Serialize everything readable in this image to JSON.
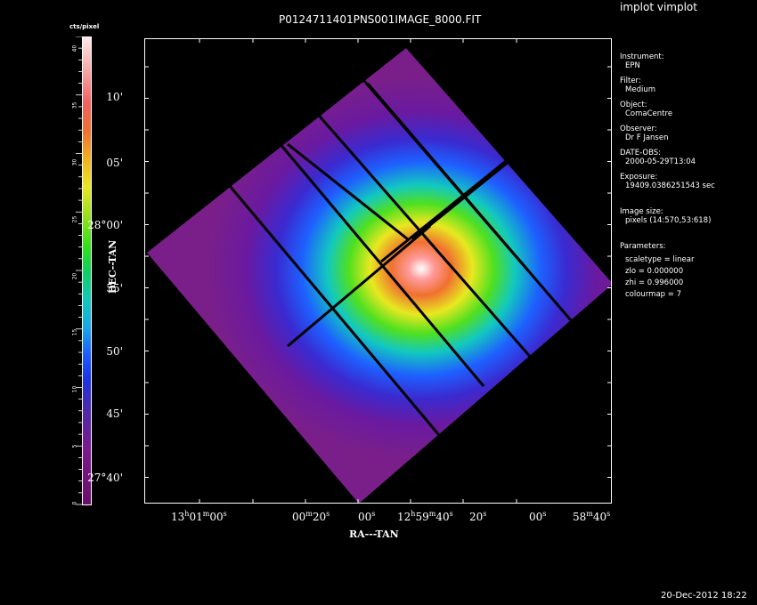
{
  "app": {
    "title": "implot vimplot"
  },
  "plot": {
    "title": "P0124711401PNS001IMAGE_8000.FIT",
    "colorbar": {
      "title": "cts/pixel",
      "ticks": [
        "40",
        "35",
        "30",
        "25",
        "20",
        "15",
        "10",
        "5",
        "0"
      ]
    },
    "dec_axis": {
      "title": "DEC--TAN",
      "ticks": [
        "10'",
        "05'",
        "28°00'",
        "55'",
        "50'",
        "45'",
        "27°40'"
      ]
    },
    "ra_axis": {
      "title": "RA---TAN",
      "ticks": [
        {
          "base": "13",
          "h": "h",
          "mid": "01",
          "m": "m",
          "tail": "00",
          "s": "s"
        },
        {
          "base": "",
          "h": "",
          "mid": "00",
          "m": "m",
          "tail": "20",
          "s": "s"
        },
        {
          "base": "",
          "h": "",
          "mid": "",
          "m": "",
          "tail": "00",
          "s": "s"
        },
        {
          "base": "12",
          "h": "h",
          "mid": "59",
          "m": "m",
          "tail": "40",
          "s": "s"
        },
        {
          "base": "",
          "h": "",
          "mid": "",
          "m": "",
          "tail": "20",
          "s": "s"
        },
        {
          "base": "",
          "h": "",
          "mid": "",
          "m": "",
          "tail": "00",
          "s": "s"
        },
        {
          "base": "",
          "h": "",
          "mid": "58",
          "m": "m",
          "tail": "40",
          "s": "s"
        }
      ]
    }
  },
  "info": {
    "instrument_label": "Instrument:",
    "instrument_value": "EPN",
    "filter_label": "Filter:",
    "filter_value": "Medium",
    "object_label": "Object:",
    "object_value": "ComaCentre",
    "observer_label": "Observer:",
    "observer_value": "Dr F Jansen",
    "date_label": "DATE-OBS:",
    "date_value": "2000-05-29T13:04",
    "exposure_label": "Exposure:",
    "exposure_value": "19409.0386251543 sec",
    "image_size_label": "Image size:",
    "image_size_value": "pixels (14:570,53:618)",
    "parameters_label": "Parameters:",
    "param_scaletype": "scaletype = linear",
    "param_zlo": "zlo = 0.000000",
    "param_zhi": "zhi = 0.996000",
    "param_colourmap": "colourmap =   7"
  },
  "footer": {
    "timestamp": "20-Dec-2012 18:22"
  },
  "colors": {
    "background": "#000000",
    "frame": "#ffffff"
  }
}
